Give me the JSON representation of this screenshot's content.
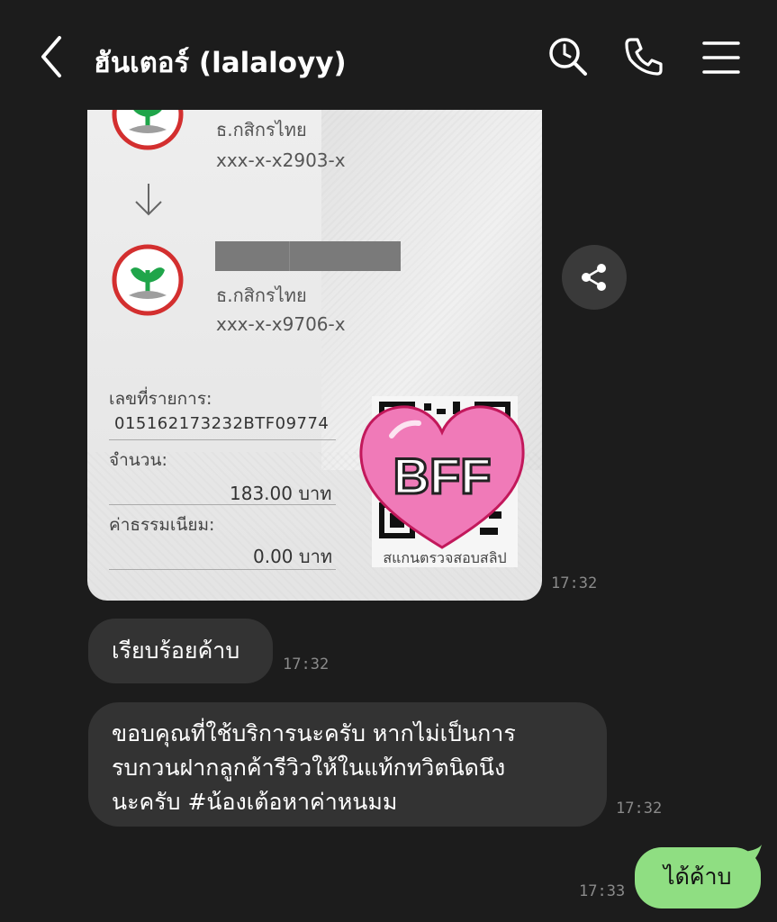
{
  "header": {
    "title": "ฮันเตอร์ (lalaloyy)",
    "icons": [
      "back-chevron-icon",
      "search-icon",
      "phone-icon",
      "menu-icon"
    ]
  },
  "slip": {
    "sender_bank": "ธ.กสิกรไทย",
    "sender_account": "xxx-x-x2903-x",
    "receiver_bank": "ธ.กสิกรไทย",
    "receiver_account": "xxx-x-x9706-x",
    "ref_label": "เลขที่รายการ:",
    "ref_value": "015162173232BTF09774",
    "amount_label": "จำนวน:",
    "amount_value": "183.00 บาท",
    "fee_label": "ค่าธรรมเนียม:",
    "fee_value": "0.00 บาท",
    "qr_caption": "สแกนตรวจสอบสลิป",
    "sticker_text": "BFF",
    "time": "17:32"
  },
  "messages": [
    {
      "side": "incoming",
      "text": "เรียบร้อยค้าบ",
      "time": "17:32"
    },
    {
      "side": "incoming",
      "lines": [
        "ขอบคุณที่ใช้บริการนะครับ  หากไม่เป็นการ",
        "รบกวนฝากลูกค้ารีวิวให้ในแท้กทวิตนิดนึง",
        "นะครับ #น้องเต้อหาค่าหนมม"
      ],
      "time": "17:32"
    },
    {
      "side": "outgoing",
      "text": "ได้ค้าบ",
      "time": "17:33"
    }
  ],
  "colors": {
    "background": "#1c1c1c",
    "incoming_bubble": "#333333",
    "outgoing_bubble": "#8fde82",
    "kbank_green": "#1fa54a",
    "kbank_red": "#d32f2f",
    "heart_pink": "#f07ab8"
  }
}
